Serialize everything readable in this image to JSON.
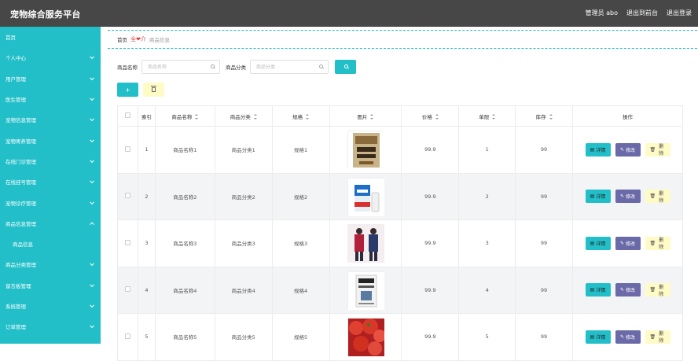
{
  "header": {
    "title": "宠物综合服务平台",
    "admin": "管理员 abo",
    "to_front": "退出到前台",
    "logout": "退出登录"
  },
  "sidebar": {
    "items": [
      {
        "label": "首页",
        "chevron": false
      },
      {
        "label": "个人中心",
        "chevron": true
      },
      {
        "label": "用户管理",
        "chevron": true
      },
      {
        "label": "医生管理",
        "chevron": true
      },
      {
        "label": "宠物信息管理",
        "chevron": true
      },
      {
        "label": "宠物寄养管理",
        "chevron": true
      },
      {
        "label": "在线门诊管理",
        "chevron": true
      },
      {
        "label": "在线挂号管理",
        "chevron": true
      },
      {
        "label": "宠物诊疗管理",
        "chevron": true
      },
      {
        "label": "商品信息管理",
        "chevron": "up"
      },
      {
        "label": "商品信息",
        "chevron": false,
        "sub": true
      },
      {
        "label": "商品分类管理",
        "chevron": true
      },
      {
        "label": "留言板管理",
        "chevron": true
      },
      {
        "label": "系统管理",
        "chevron": true
      },
      {
        "label": "订单管理",
        "chevron": true
      }
    ]
  },
  "breadcrumb": {
    "home": "首页",
    "separator": "全❤介",
    "current": "商品信息"
  },
  "search": {
    "name_label": "商品名称",
    "name_placeholder": "商品名称",
    "category_label": "商品分类",
    "category_placeholder": "商品分类"
  },
  "actions": {
    "add_label": "+"
  },
  "table": {
    "headers": [
      "索引",
      "商品名称",
      "商品分类",
      "规格",
      "图片",
      "价格",
      "单限",
      "库存",
      "操作"
    ],
    "detail_label": "详情",
    "edit_label": "修改",
    "delete_label": "删除",
    "rows": [
      {
        "index": "1",
        "name": "商品名称1",
        "category": "商品分类1",
        "spec": "规格1",
        "image": "book-cover",
        "price": "99.9",
        "limit": "1",
        "stock": "99"
      },
      {
        "index": "2",
        "name": "商品名称2",
        "category": "商品分类2",
        "spec": "规格2",
        "image": "milk-carton",
        "price": "99.9",
        "limit": "2",
        "stock": "99"
      },
      {
        "index": "3",
        "name": "商品名称3",
        "category": "商品分类3",
        "spec": "规格3",
        "image": "women-clothing",
        "price": "99.9",
        "limit": "3",
        "stock": "99"
      },
      {
        "index": "4",
        "name": "商品名称4",
        "category": "商品分类4",
        "spec": "规格4",
        "image": "book-white",
        "price": "99.9",
        "limit": "4",
        "stock": "99"
      },
      {
        "index": "5",
        "name": "商品名称5",
        "category": "商品分类5",
        "spec": "规格5",
        "image": "tomatoes",
        "price": "99.9",
        "limit": "5",
        "stock": "99"
      }
    ]
  },
  "colors": {
    "accent": "#23bfc9",
    "topbar": "#474747",
    "edit": "#6b6aa8",
    "delete": "#fffbc7"
  }
}
